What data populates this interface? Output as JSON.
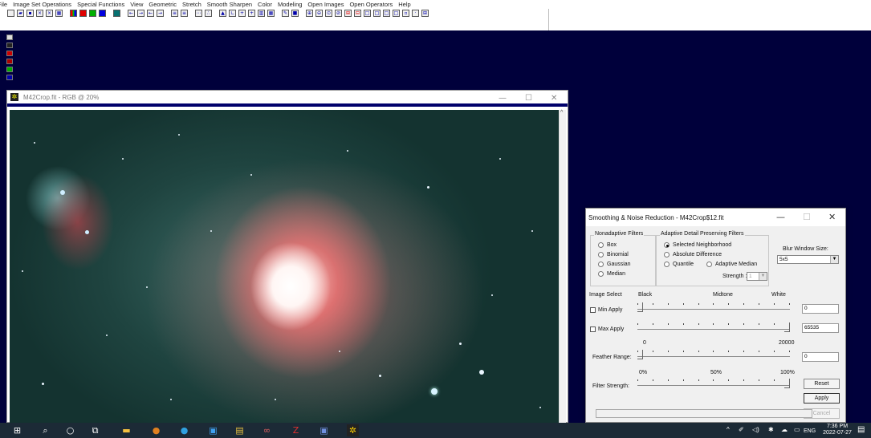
{
  "menu": [
    "File",
    "Image Set Operations",
    "Special Functions",
    "View",
    "Geometric",
    "Stretch",
    "Smooth Sharpen",
    "Color",
    "Modeling",
    "Open Images",
    "Open Operators",
    "Help"
  ],
  "image_window": {
    "title": "M42Crop.fit - RGB @ 20%",
    "minimize": "—",
    "maximize": "☐",
    "close": "✕"
  },
  "dialog": {
    "title": "Smoothing & Noise Reduction - M42Crop$12.fit",
    "minimize": "—",
    "maximize": "☐",
    "close": "✕",
    "nonadaptive": {
      "label": "Nonadaptive Filters",
      "options": [
        "Box",
        "Binomial",
        "Gaussian",
        "Median"
      ]
    },
    "adaptive": {
      "label": "Adaptive Detail Preserving Filters",
      "selected_neighborhood": "Selected Neighborhood",
      "absolute_difference": "Absolute Difference",
      "quantile": "Quantile",
      "adaptive_median": "Adaptive Median",
      "strength_label": "Strength :",
      "strength_value": "1"
    },
    "blur_window": {
      "label": "Blur Window Size:",
      "value": "5x5"
    },
    "image_select": {
      "label": "Image Select",
      "black": "Black",
      "midtone": "Midtone",
      "white": "White"
    },
    "min_apply": {
      "label": "Min Apply",
      "value": "0"
    },
    "max_apply": {
      "label": "Max Apply",
      "value": "65535"
    },
    "feather": {
      "label": "Feather Range:",
      "scale_min": "0",
      "scale_max": "20000",
      "value": "0"
    },
    "filter_strength": {
      "label": "Filter Strength:",
      "scale_0": "0%",
      "scale_50": "50%",
      "scale_100": "100%"
    },
    "buttons": {
      "reset": "Reset",
      "apply": "Apply",
      "cancel": "Cancel"
    }
  },
  "taskbar": {
    "language": "ENG",
    "time": "7:36 PM",
    "date": "2022-07-27"
  }
}
